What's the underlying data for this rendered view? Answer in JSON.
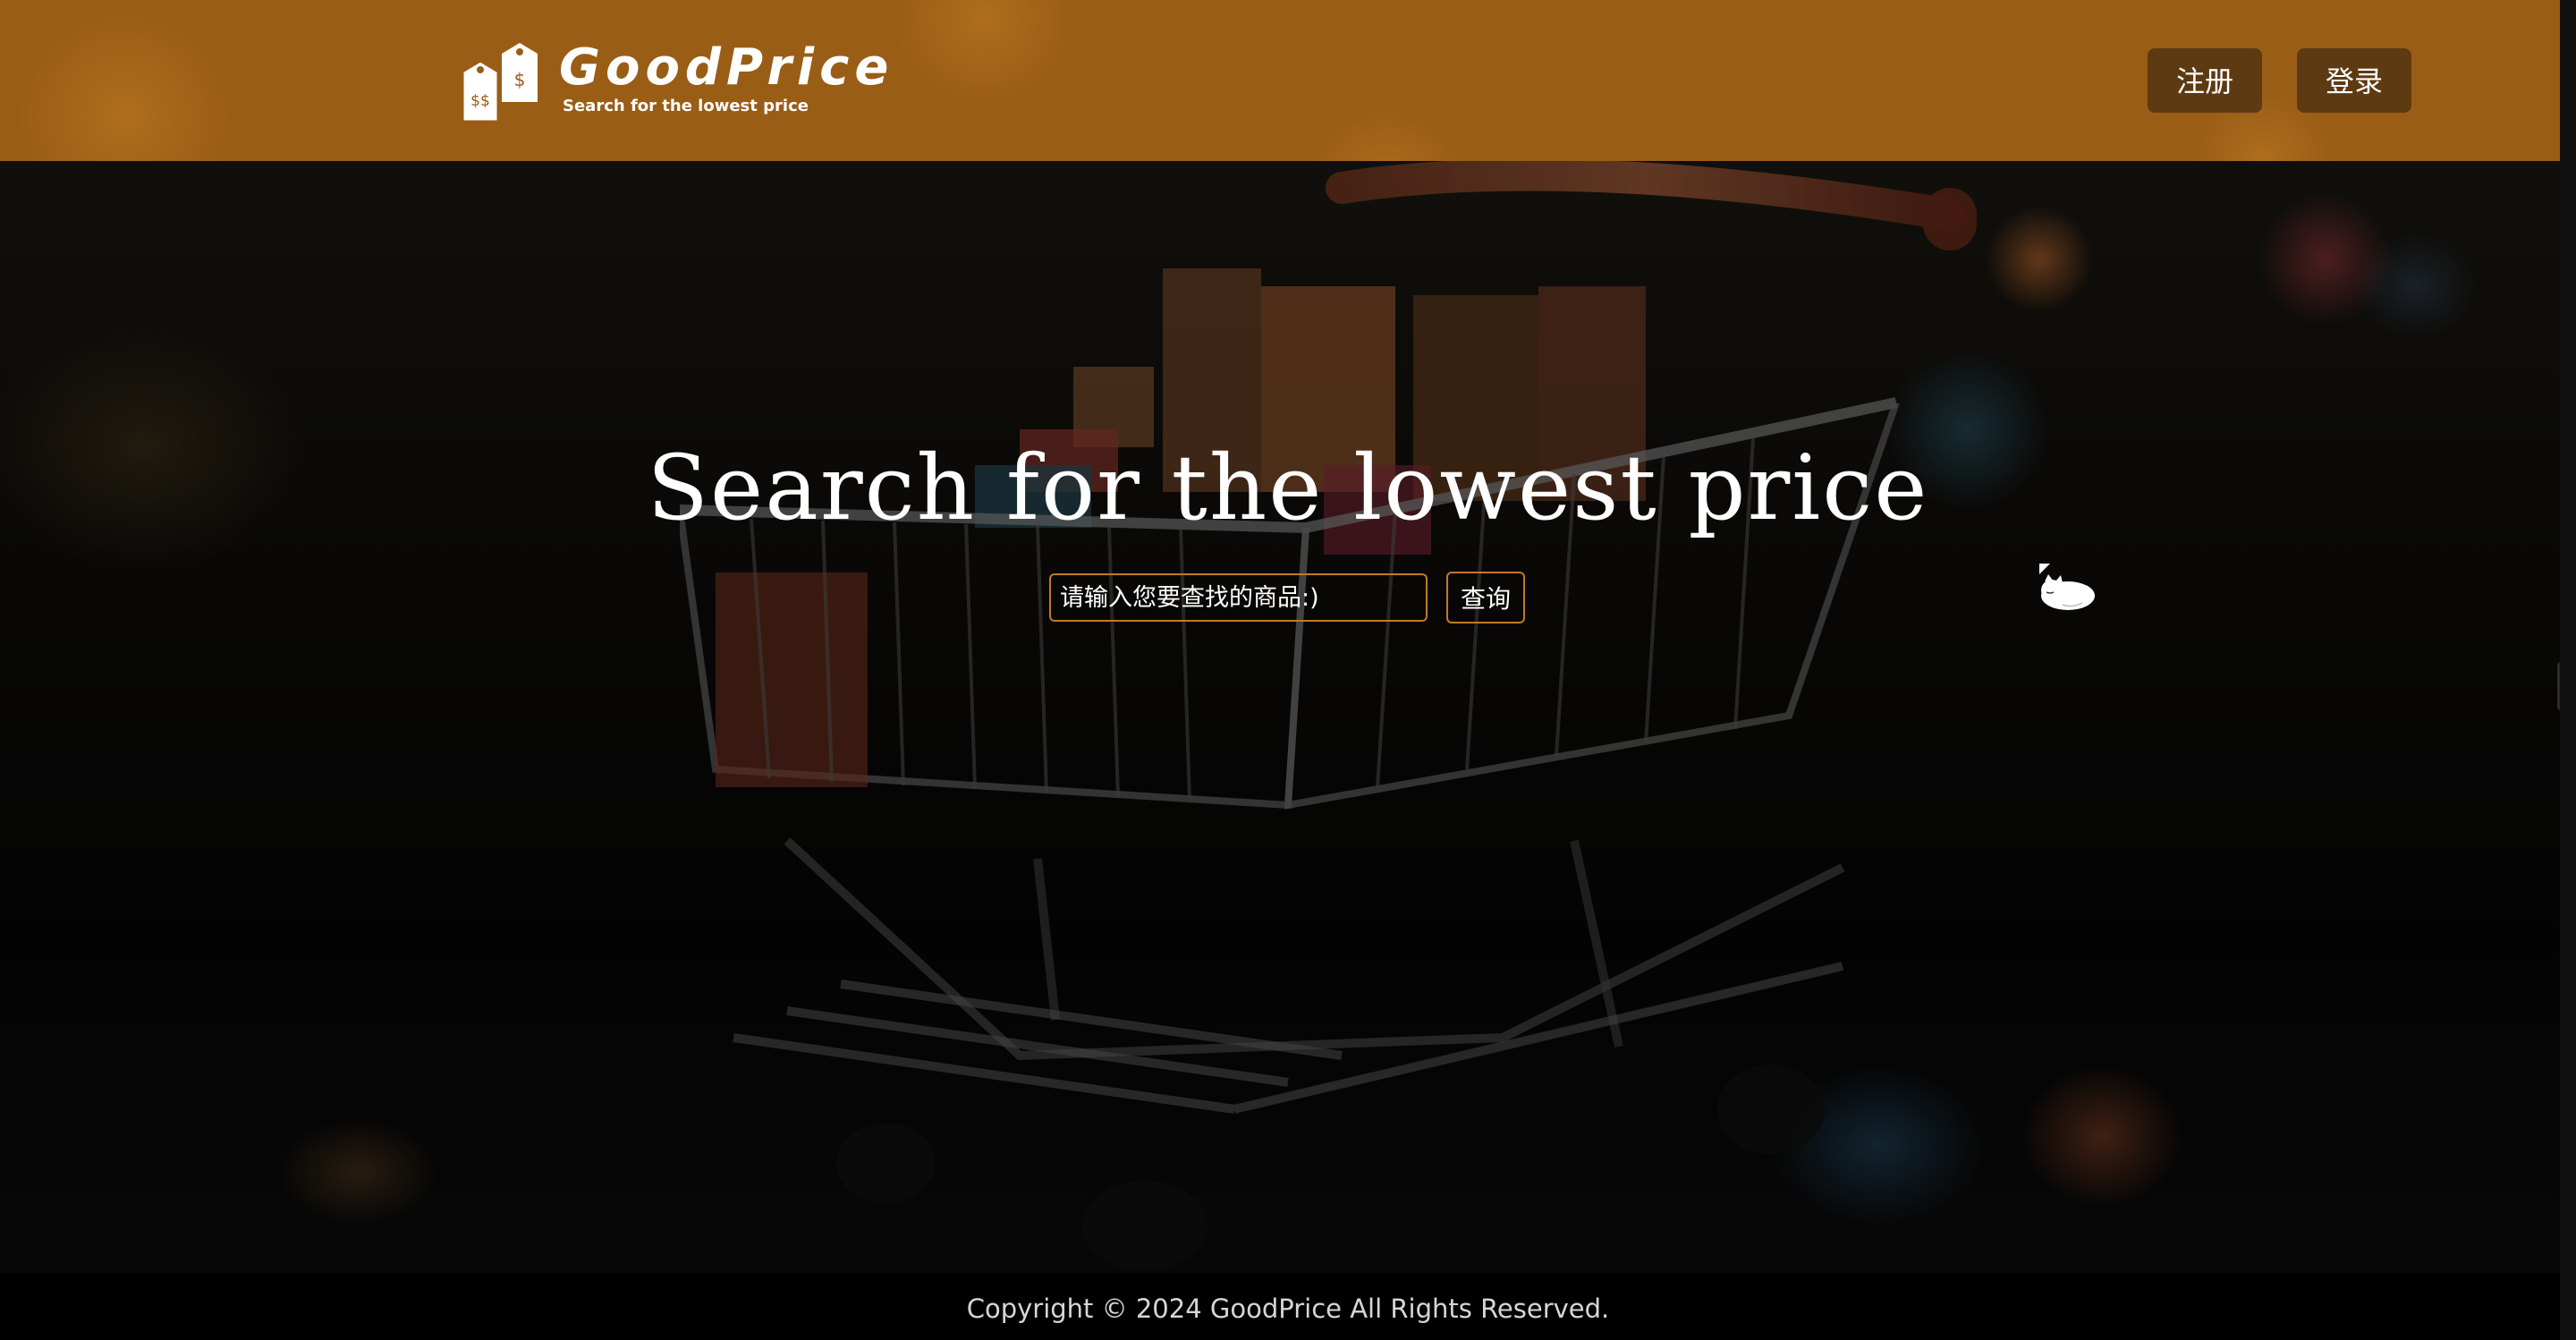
{
  "header": {
    "logo": {
      "title": "GoodPrice",
      "subtitle": "Search for the lowest price",
      "tag_symbols": [
        "$$",
        "$"
      ]
    },
    "register_label": "注册",
    "login_label": "登录"
  },
  "hero": {
    "title": "Search for the lowest price",
    "search": {
      "placeholder": "请输入您要查找的商品:)",
      "button_label": "查询"
    }
  },
  "footer": {
    "copyright": "Copyright © 2024 GoodPrice All Rights Reserved."
  },
  "colors": {
    "header_bg": "#9a5d16",
    "nav_button_bg": "#5e3a12",
    "accent_border": "#c07a28",
    "footer_bg": "#000000"
  },
  "icons": {
    "logo": "price-tags-icon",
    "mascot": "sleeping-cat-icon",
    "side_tab": "collapse-left-arrow-icon"
  }
}
